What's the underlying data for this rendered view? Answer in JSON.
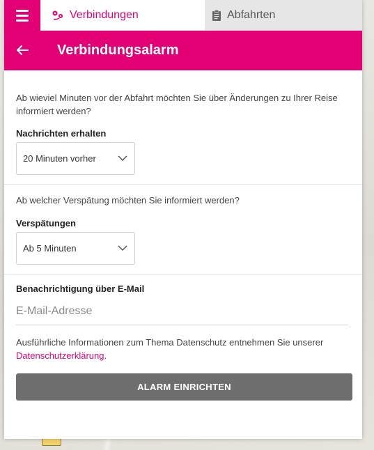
{
  "tabs": {
    "connections_label": "Verbindungen",
    "departures_label": "Abfahrten"
  },
  "header": {
    "title": "Verbindungsalarm"
  },
  "notifications": {
    "question": "Ab wieviel Minuten vor der Abfahrt möchten Sie über Änderungen zu Ihrer Reise informiert werden?",
    "label": "Nachrichten erhalten",
    "selected": "20 Minuten vorher"
  },
  "delays": {
    "question": "Ab welcher Verspätung möchten Sie informiert werden?",
    "label": "Verspätungen",
    "selected": "Ab 5 Minuten"
  },
  "email": {
    "label": "Benachrichtigung über E-Mail",
    "placeholder": "E-Mail-Adresse"
  },
  "privacy": {
    "text": "Ausführliche Informationen zum Thema Datenschutz entnehmen Sie unserer ",
    "link": "Datenschutzerklärung",
    "suffix": "."
  },
  "submit_label": "ALARM EINRICHTEN",
  "colors": {
    "brand": "#e20074",
    "button": "#6e6e6e"
  }
}
